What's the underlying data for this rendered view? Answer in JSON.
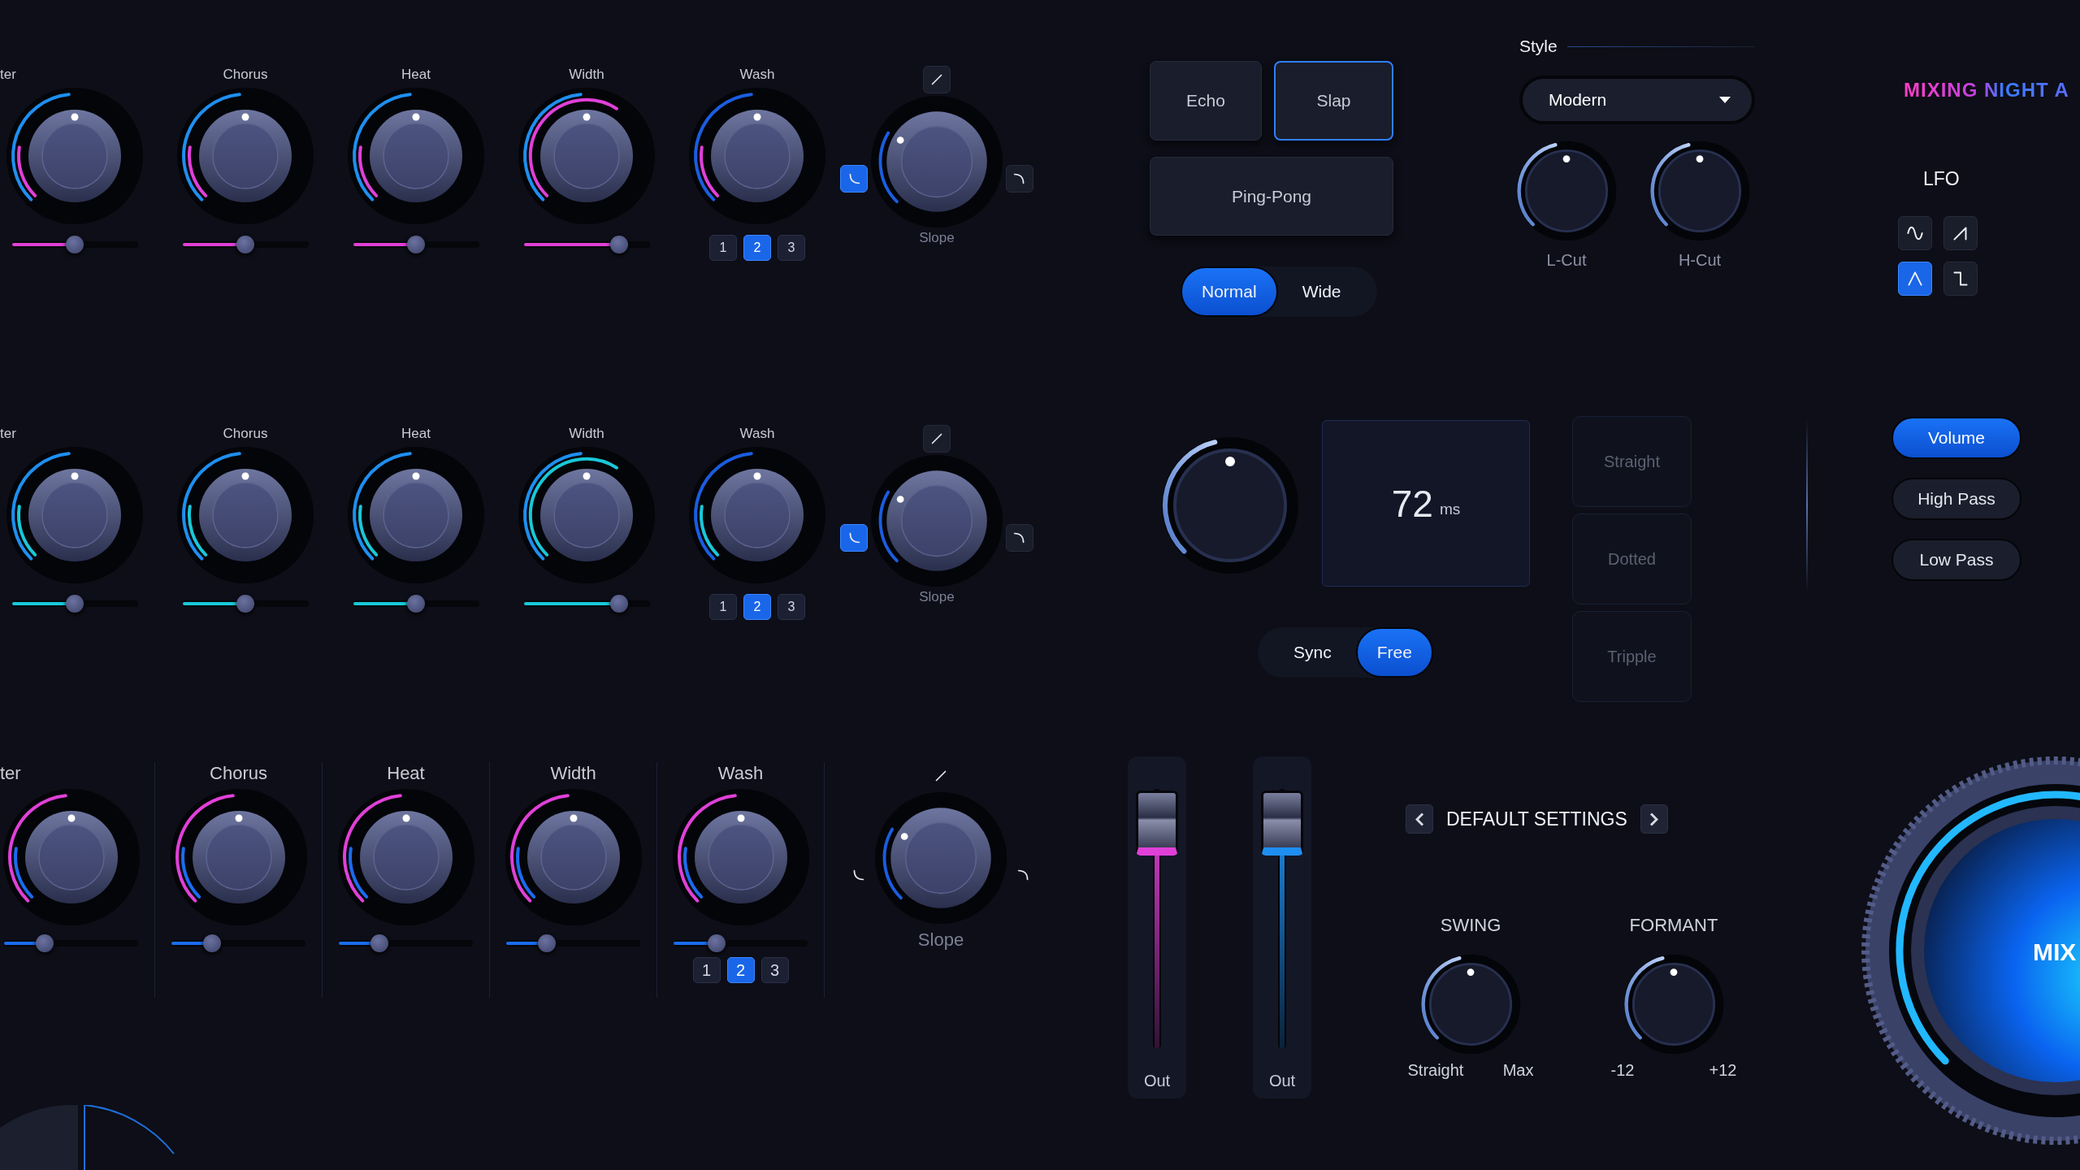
{
  "rows": [
    {
      "kind": "compact",
      "color": "#e040d8",
      "knobs": [
        {
          "label": "ter",
          "slider": {
            "level": 0.5
          }
        },
        {
          "label": "Chorus",
          "slider": {
            "level": 0.5
          }
        },
        {
          "label": "Heat",
          "slider": {
            "level": 0.5
          }
        },
        {
          "label": "Width",
          "slider": {
            "level": 0.76
          }
        },
        {
          "label": "Wash",
          "options": [
            {
              "label": "1",
              "selected": false
            },
            {
              "label": "2",
              "selected": true
            },
            {
              "label": "3",
              "selected": false
            }
          ]
        }
      ],
      "slope": {
        "label": "Slope",
        "shapes": [
          {
            "kind": "linear",
            "selected": false
          },
          {
            "kind": "concave",
            "selected": true
          },
          {
            "kind": "convex",
            "selected": false
          }
        ]
      }
    },
    {
      "kind": "compact",
      "color": "#19c8d8",
      "knobs": [
        {
          "label": "ter",
          "slider": {
            "level": 0.5
          }
        },
        {
          "label": "Chorus",
          "slider": {
            "level": 0.5
          }
        },
        {
          "label": "Heat",
          "slider": {
            "level": 0.5
          }
        },
        {
          "label": "Width",
          "slider": {
            "level": 0.76
          }
        },
        {
          "label": "Wash",
          "options": [
            {
              "label": "1",
              "selected": false
            },
            {
              "label": "2",
              "selected": true
            },
            {
              "label": "3",
              "selected": false
            }
          ]
        }
      ],
      "slope": {
        "label": "Slope",
        "shapes": [
          {
            "kind": "linear",
            "selected": false
          },
          {
            "kind": "concave",
            "selected": true
          },
          {
            "kind": "convex",
            "selected": false
          }
        ]
      }
    },
    {
      "kind": "large",
      "color": "#1a6cf0",
      "knobs": [
        {
          "label": "ter",
          "slider": {
            "level": 0.3
          }
        },
        {
          "label": "Chorus",
          "slider": {
            "level": 0.3
          }
        },
        {
          "label": "Heat",
          "slider": {
            "level": 0.3
          }
        },
        {
          "label": "Width",
          "slider": {
            "level": 0.3
          }
        },
        {
          "label": "Wash",
          "slider": {
            "level": 0.32
          },
          "options": [
            {
              "label": "1",
              "selected": false
            },
            {
              "label": "2",
              "selected": true
            },
            {
              "label": "3",
              "selected": false
            }
          ]
        }
      ],
      "slope": {
        "label": "Slope",
        "shapes": [
          {
            "kind": "linear",
            "selected": false
          },
          {
            "kind": "concave",
            "selected": false
          },
          {
            "kind": "convex",
            "selected": false
          }
        ]
      }
    }
  ],
  "delay_modes": [
    {
      "label": "Echo",
      "selected": false
    },
    {
      "label": "Slap",
      "selected": true
    },
    {
      "label": "Ping-Pong",
      "selected": false
    }
  ],
  "stereo": [
    {
      "label": "Normal",
      "selected": true
    },
    {
      "label": "Wide",
      "selected": false
    }
  ],
  "style": {
    "label": "Style",
    "value": "Modern",
    "knobs": [
      {
        "label": "L-Cut"
      },
      {
        "label": "H-Cut"
      }
    ]
  },
  "logo": "MIXING NIGHT A",
  "lfo": {
    "label": "LFO",
    "waves": [
      {
        "kind": "sine",
        "selected": false
      },
      {
        "kind": "ramp",
        "selected": false
      },
      {
        "kind": "triangle",
        "selected": true
      },
      {
        "kind": "step",
        "selected": false
      }
    ]
  },
  "time": {
    "value": "72",
    "unit": "ms",
    "sync": [
      {
        "label": "Sync",
        "selected": false
      },
      {
        "label": "Free",
        "selected": true
      }
    ],
    "divisions": [
      {
        "label": "Straight",
        "disabled": true
      },
      {
        "label": "Dotted",
        "disabled": true
      },
      {
        "label": "Tripple",
        "disabled": true
      }
    ]
  },
  "filters": [
    {
      "label": "Volume",
      "selected": true
    },
    {
      "label": "High Pass",
      "selected": false
    },
    {
      "label": "Low Pass",
      "selected": false
    }
  ],
  "faders": [
    {
      "label": "Out",
      "level": 0.92,
      "color": "#e040d8"
    },
    {
      "label": "Out",
      "level": 0.92,
      "color": "#1e8ff0"
    }
  ],
  "preset": {
    "name": "DEFAULT SETTINGS"
  },
  "params": [
    {
      "label": "SWING",
      "min": "Straight",
      "max": "Max"
    },
    {
      "label": "FORMANT",
      "min": "-12",
      "max": "+12"
    }
  ],
  "mix": {
    "label": "MIX"
  }
}
